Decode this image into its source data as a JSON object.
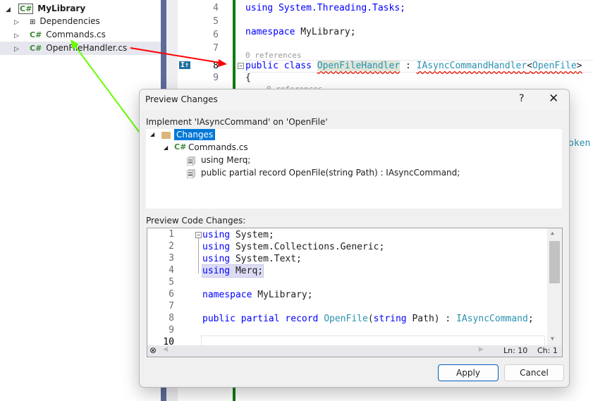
{
  "solution_explorer": {
    "items": [
      {
        "label": "MyLibrary",
        "icon": "csharp-project-icon",
        "expanded": true
      },
      {
        "label": "Dependencies",
        "icon": "dependencies-icon"
      },
      {
        "label": "Commands.cs",
        "icon": "csharp-file-icon"
      },
      {
        "label": "OpenFileHandler.cs",
        "icon": "csharp-file-icon",
        "selected": true
      }
    ]
  },
  "editor": {
    "line_numbers": [
      "4",
      "5",
      "6",
      "7",
      "8",
      "9"
    ],
    "line4": "using System.Threading.Tasks;",
    "namespace_kw": "namespace",
    "namespace_name": " MyLibrary;",
    "references": "0 references",
    "references2": "0 references",
    "public_kw": "public",
    "class_kw": "class",
    "class_name": "OpenFileHandler",
    "colon": " : ",
    "iface": "IAsyncCommandHandler",
    "lt": "<",
    "generic": "OpenFile",
    "gt": ">",
    "brace": "{",
    "partial_text": "oken",
    "codelens_icon": "I↑"
  },
  "dialog": {
    "title": "Preview Changes",
    "help": "?",
    "close_icon": "close-icon",
    "description": "Implement 'IAsyncCommand' on 'OpenFile'",
    "tree": {
      "root": "Changes",
      "file": "Commands.cs",
      "changes": [
        "using Merq;",
        "public partial record OpenFile(string Path) : IAsyncCommand;"
      ]
    },
    "preview_label": "Preview Code Changes:",
    "code_lines": [
      {
        "n": "1",
        "kw": "using",
        "rest": " System;"
      },
      {
        "n": "2",
        "kw": "using",
        "rest": " System.Collections.Generic;"
      },
      {
        "n": "3",
        "kw": "using",
        "rest": " System.Text;"
      },
      {
        "n": "4",
        "kw": "using",
        "rest": " Merq;"
      },
      {
        "n": "5"
      },
      {
        "n": "6",
        "kw": "namespace",
        "rest": " MyLibrary;"
      },
      {
        "n": "7"
      },
      {
        "n": "8"
      },
      {
        "n": "9"
      },
      {
        "n": "10"
      }
    ],
    "line8": {
      "k1": "public",
      "k2": "partial",
      "k3": "record",
      "name": "OpenFile",
      "p1": "(",
      "k4": "string",
      "p2": " Path) : ",
      "iface": "IAsyncCommand",
      "end": ";"
    },
    "status": {
      "ln": "Ln: 10",
      "ch": "Ch: 1"
    },
    "apply": "Apply",
    "cancel": "Cancel"
  },
  "colors": {
    "keyword": "#0000ff",
    "type": "#2b91af",
    "selection": "#0078d7",
    "arrow_red": "#ff0000",
    "arrow_green": "#66ff00"
  }
}
